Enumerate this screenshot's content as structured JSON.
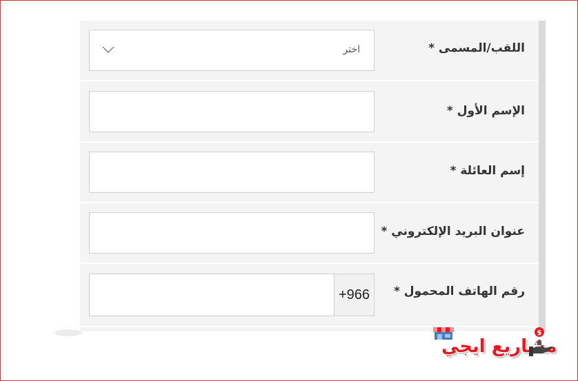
{
  "form": {
    "title_field": {
      "label": "اللقب/المسمى *",
      "selected": "اختر"
    },
    "first_name": {
      "label": "الإسم الأول *",
      "value": ""
    },
    "last_name": {
      "label": "إسم العائلة *",
      "value": ""
    },
    "email": {
      "label": "عنوان البريد الإلكتروني *",
      "value": ""
    },
    "mobile": {
      "label": "رقم الهاتف المحمول *",
      "prefix": "+966",
      "value": ""
    }
  },
  "logo": {
    "text": "مشاريع ايجي",
    "icons": [
      "shop-icon",
      "money-hand-icon"
    ]
  },
  "colors": {
    "frame_border": "#d32f2f",
    "form_bg": "#f4f4f4",
    "logo_red": "#e21b23"
  }
}
